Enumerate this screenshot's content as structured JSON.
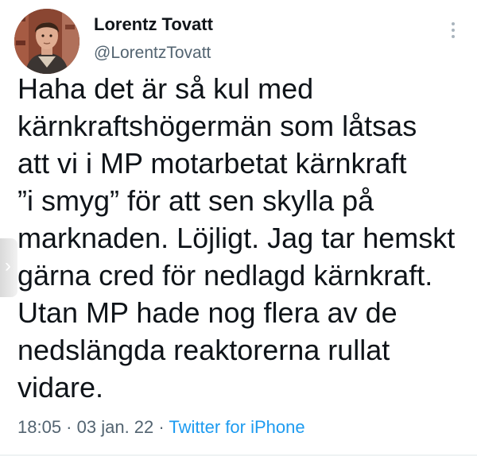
{
  "author": {
    "name": "Lorentz Tovatt",
    "handle": "@LorentzTovatt",
    "avatar_icon": "profile-photo"
  },
  "tweet": {
    "lines": [
      "Haha det är så kul med",
      "kärnkraftshögermän som låtsas",
      "att vi i MP motarbetat kärnkraft",
      "”i smyg” för att sen skylla på",
      "marknaden. Löjligt. Jag tar hemskt",
      "gärna cred för nedlagd kärnkraft.",
      "Utan MP hade nog flera av de",
      "nedslängda reaktorerna rullat",
      "vidare."
    ]
  },
  "meta": {
    "time": "18:05",
    "separator": " · ",
    "date": "03 jan. 22",
    "source": "Twitter for iPhone"
  },
  "colors": {
    "text": "#0f1419",
    "secondary": "#536471",
    "link": "#1d9bf0"
  },
  "icons": {
    "more": "more-vertical-icon",
    "left_edge": "chevron-left-icon"
  }
}
